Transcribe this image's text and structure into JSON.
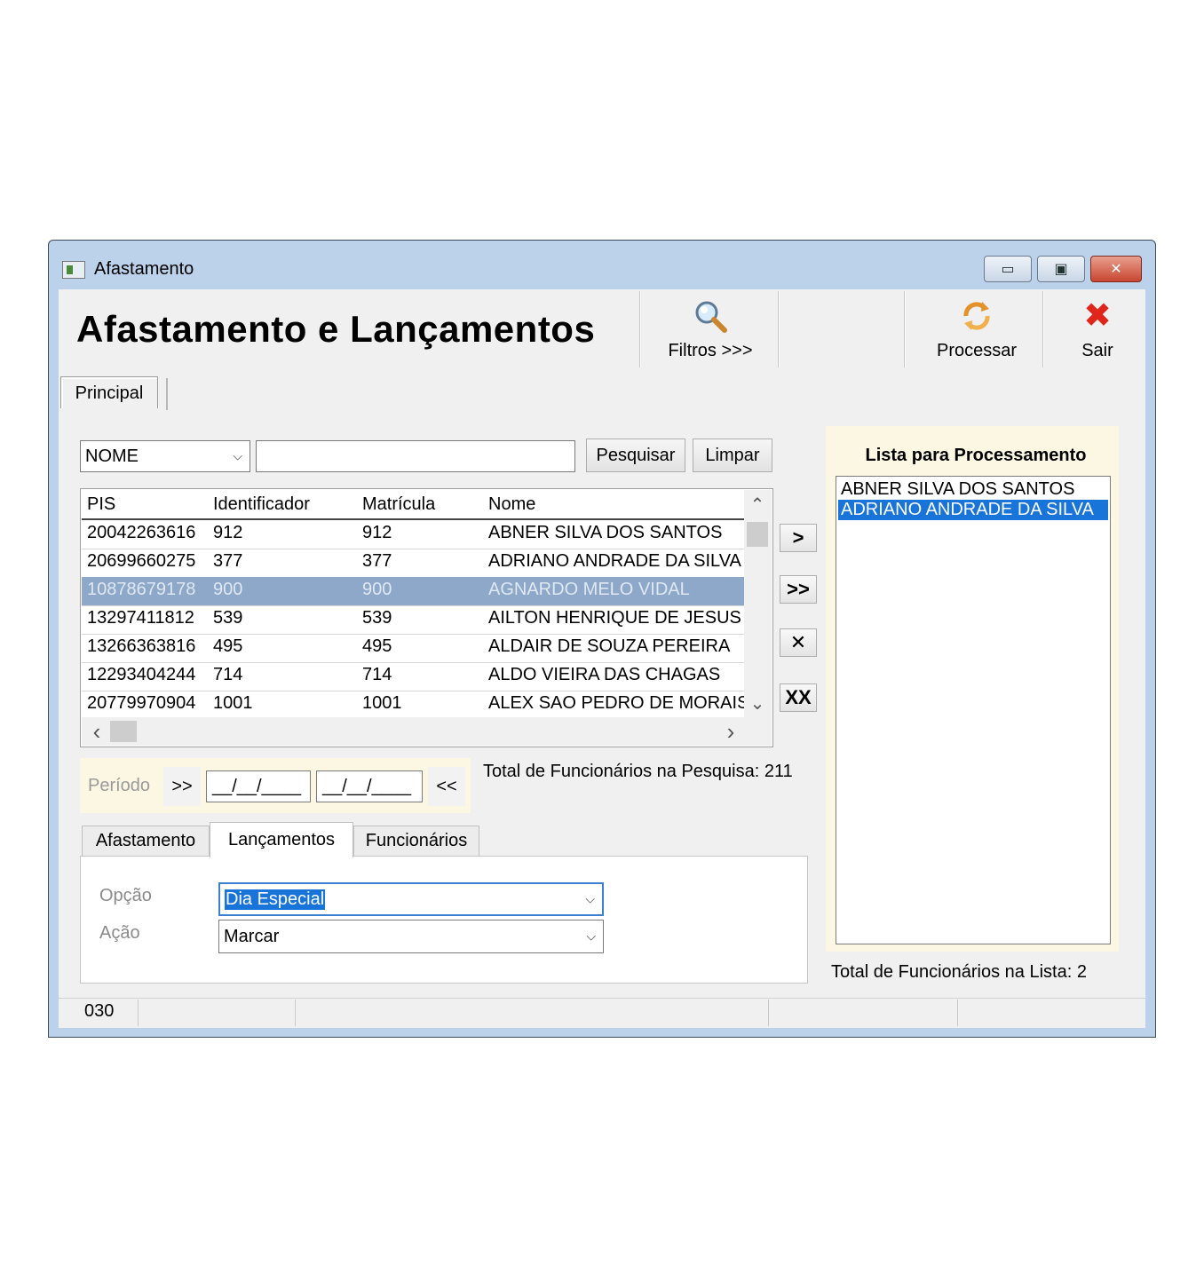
{
  "window": {
    "title": "Afastamento",
    "minimize_glyph": "▭",
    "maximize_glyph": "▣",
    "close_glyph": "✕"
  },
  "header": {
    "title": "Afastamento e Lançamentos"
  },
  "toolbar": {
    "filtros_label": "Filtros >>>",
    "processar_label": "Processar",
    "sair_label": "Sair",
    "sair_icon": "✖"
  },
  "tabs": {
    "principal": "Principal"
  },
  "search": {
    "field_select": "NOME",
    "query": "",
    "search_button": "Pesquisar",
    "clear_button": "Limpar"
  },
  "grid": {
    "columns": [
      "PIS",
      "Identificador",
      "Matrícula",
      "Nome"
    ],
    "rows": [
      [
        "20042263616",
        "912",
        "912",
        "ABNER SILVA DOS SANTOS"
      ],
      [
        "20699660275",
        "377",
        "377",
        "ADRIANO ANDRADE DA SILVA"
      ],
      [
        "10878679178",
        "900",
        "900",
        "AGNARDO MELO VIDAL"
      ],
      [
        "13297411812",
        "539",
        "539",
        "AILTON HENRIQUE DE JESUS"
      ],
      [
        "13266363816",
        "495",
        "495",
        "ALDAIR DE SOUZA PEREIRA"
      ],
      [
        "12293404244",
        "714",
        "714",
        "ALDO VIEIRA DAS CHAGAS"
      ],
      [
        "20779970904",
        "1001",
        "1001",
        "ALEX SAO PEDRO DE MORAIS"
      ]
    ],
    "selected_row": 2,
    "scroll_up": "⌃",
    "scroll_down": "⌄",
    "scroll_left": "‹",
    "scroll_right": "›"
  },
  "move_buttons": {
    "add_one": ">",
    "add_all": ">>",
    "remove_one": "✕",
    "remove_all": "XX"
  },
  "periodo": {
    "label": "Período",
    "prev": ">>",
    "start_date": "__/__/____",
    "end_date": "__/__/____",
    "next": "<<"
  },
  "total_pesquisa": "Total de Funcionários na Pesquisa: 211",
  "subtabs": [
    "Afastamento",
    "Lançamentos",
    "Funcionários"
  ],
  "active_subtab": "Lançamentos",
  "lancamentos": {
    "opcao_label": "Opção",
    "opcao_value": "Dia Especial",
    "acao_label": "Ação",
    "acao_value": "Marcar"
  },
  "lista": {
    "title": "Lista para Processamento",
    "items": [
      "ABNER SILVA DOS SANTOS",
      "ADRIANO ANDRADE DA SILVA"
    ],
    "selected_index": 1,
    "total": "Total de Funcionários na Lista: 2"
  },
  "statusbar": {
    "code": "030"
  },
  "colors": {
    "selection_blue": "#1874d8",
    "grid_selection": "#8ea8c9",
    "panel_cream": "#fbf7e3",
    "window_frame": "#bcd2ea",
    "close_red": "#c74530"
  }
}
